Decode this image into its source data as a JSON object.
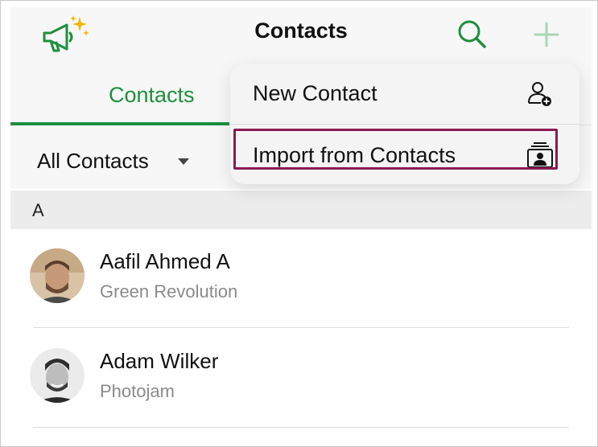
{
  "navbar": {
    "title": "Contacts",
    "left_icon": "announcement-icon",
    "search_icon": "search-icon",
    "add_icon": "add-icon"
  },
  "tabs": {
    "active_label": "Contacts"
  },
  "filter": {
    "label": "All Contacts"
  },
  "section": {
    "letter": "A"
  },
  "contacts": [
    {
      "name": "Aafil Ahmed A",
      "company": "Green Revolution"
    },
    {
      "name": "Adam Wilker",
      "company": "Photojam"
    }
  ],
  "menu": {
    "items": [
      {
        "label": "New Contact",
        "icon": "add-person-icon"
      },
      {
        "label": "Import from Contacts",
        "icon": "contact-card-stack-icon"
      }
    ]
  },
  "colors": {
    "accent": "#1e8f3e",
    "highlight": "#8a1a52"
  }
}
